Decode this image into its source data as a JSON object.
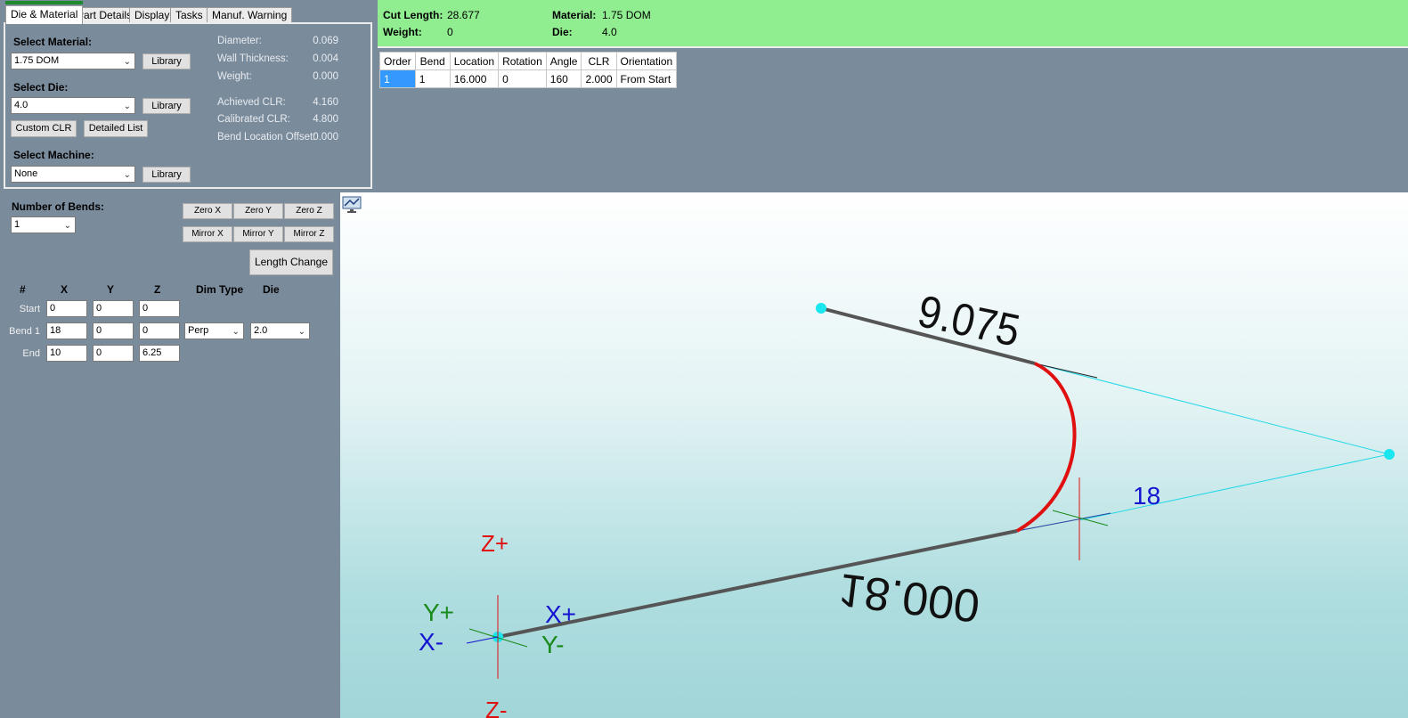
{
  "tabs": [
    "Die & Material",
    "Part Details",
    "Display",
    "Tasks",
    "Manuf. Warning"
  ],
  "material_panel": {
    "select_material_label": "Select Material:",
    "material_value": "1.75 DOM",
    "select_die_label": "Select Die:",
    "die_value": "4.0",
    "select_machine_label": "Select Machine:",
    "machine_value": "None",
    "library_label": "Library",
    "custom_clr_label": "Custom CLR",
    "detailed_list_label": "Detailed List",
    "properties": [
      {
        "label": "Diameter:",
        "value": "0.069"
      },
      {
        "label": "Wall Thickness:",
        "value": "0.004"
      },
      {
        "label": "Weight:",
        "value": "0.000"
      },
      {
        "label": "Achieved CLR:",
        "value": "4.160"
      },
      {
        "label": "Calibrated CLR:",
        "value": "4.800"
      },
      {
        "label": "Bend Location Offset:",
        "value": "0.000"
      }
    ]
  },
  "summary": {
    "cut_length_label": "Cut Length:",
    "cut_length_value": "28.677",
    "weight_label": "Weight:",
    "weight_value": "0",
    "material_label": "Material:",
    "material_value": "1.75 DOM",
    "die_label": "Die:",
    "die_value": "4.0"
  },
  "bend_table": {
    "headers": [
      "Order",
      "Bend",
      "Location",
      "Rotation",
      "Angle",
      "CLR",
      "Orientation"
    ],
    "rows": [
      [
        "1",
        "1",
        "16.000",
        "0",
        "160",
        "2.000",
        "From Start"
      ]
    ]
  },
  "bends_panel": {
    "number_of_bends_label": "Number of Bends:",
    "number_of_bends_value": "1",
    "zero_x": "Zero X",
    "zero_y": "Zero Y",
    "zero_z": "Zero Z",
    "mirror_x": "Mirror X",
    "mirror_y": "Mirror Y",
    "mirror_z": "Mirror Z",
    "length_change": "Length Change",
    "columns": [
      "#",
      "X",
      "Y",
      "Z",
      "Dim Type",
      "Die"
    ],
    "rows": [
      {
        "label": "Start",
        "x": "0",
        "y": "0",
        "z": "0"
      },
      {
        "label": "Bend 1",
        "x": "18",
        "y": "0",
        "z": "0",
        "dim_type": "Perp",
        "die": "2.0"
      },
      {
        "label": "End",
        "x": "10",
        "y": "0",
        "z": "6.25"
      }
    ]
  },
  "viewport": {
    "dim_top": "9.075",
    "dim_bottom": "18.000",
    "dim_bend": "18",
    "axis_z_plus": "Z+",
    "axis_z_minus": "Z-",
    "axis_y_plus": "Y+",
    "axis_y_minus": "Y-",
    "axis_x_plus": "X+",
    "axis_x_minus": "X-",
    "colors": {
      "tube": "#555555",
      "bend_arc": "#e01010",
      "guide": "#22d8e8",
      "point": "#19e6ef",
      "z_axis": "#e01010",
      "y_axis": "#1a8a1a",
      "x_axis": "#1414d0"
    }
  }
}
